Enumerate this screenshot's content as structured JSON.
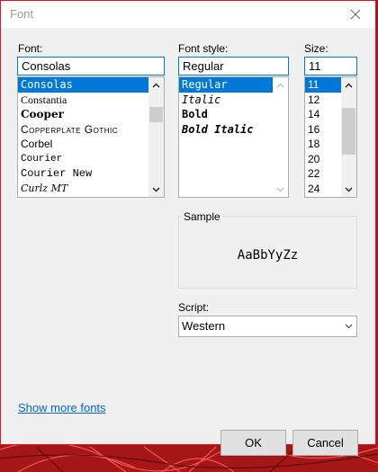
{
  "window": {
    "title": "Font"
  },
  "font": {
    "label": "Font:",
    "value": "Consolas",
    "items": [
      "Consolas",
      "Constantia",
      "Cooper",
      "Copperplate Gothic",
      "Corbel",
      "Courier",
      "Courier New",
      "Curlz MT"
    ]
  },
  "style": {
    "label": "Font style:",
    "value": "Regular",
    "items": [
      "Regular",
      "Italic",
      "Bold",
      "Bold Italic"
    ]
  },
  "size": {
    "label": "Size:",
    "value": "11",
    "items": [
      "11",
      "12",
      "14",
      "16",
      "18",
      "20",
      "22",
      "24"
    ]
  },
  "sample": {
    "label": "Sample",
    "text": "AaBbYyZz"
  },
  "script": {
    "label": "Script:",
    "value": "Western"
  },
  "more_fonts_link": "Show more fonts",
  "buttons": {
    "ok": "OK",
    "cancel": "Cancel"
  },
  "colors": {
    "accent": "#0078d7",
    "close_border": "#e81123",
    "link": "#0066cc"
  },
  "icons": [
    "close-icon",
    "chevron-up-icon",
    "chevron-down-icon"
  ]
}
